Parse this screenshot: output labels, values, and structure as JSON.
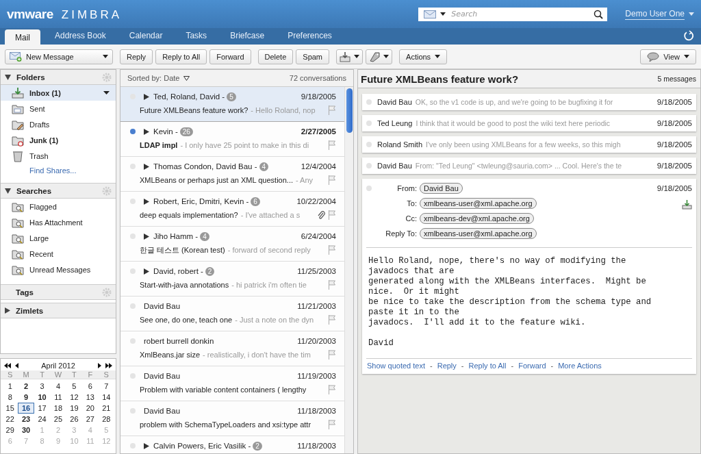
{
  "header": {
    "logo_brand": "vmware",
    "logo_product": "ZIMBRA",
    "search": {
      "placeholder": "Search"
    },
    "user": "Demo User One"
  },
  "tabs": [
    {
      "label": "Mail",
      "selected": true
    },
    {
      "label": "Address Book",
      "selected": false
    },
    {
      "label": "Calendar",
      "selected": false
    },
    {
      "label": "Tasks",
      "selected": false
    },
    {
      "label": "Briefcase",
      "selected": false
    },
    {
      "label": "Preferences",
      "selected": false
    }
  ],
  "toolbar": {
    "new_message": "New Message",
    "buttons": [
      "Reply",
      "Reply to All",
      "Forward",
      "Delete",
      "Spam"
    ],
    "actions": "Actions",
    "view": "View"
  },
  "sidebar": {
    "folders_title": "Folders",
    "folders": [
      {
        "name": "Inbox (1)",
        "kind": "inbox",
        "bold": true,
        "selected": true
      },
      {
        "name": "Sent",
        "kind": "sent",
        "bold": false,
        "selected": false
      },
      {
        "name": "Drafts",
        "kind": "drafts",
        "bold": false,
        "selected": false
      },
      {
        "name": "Junk (1)",
        "kind": "junk",
        "bold": true,
        "selected": false
      },
      {
        "name": "Trash",
        "kind": "trash",
        "bold": false,
        "selected": false
      }
    ],
    "find_shares": "Find Shares...",
    "searches_title": "Searches",
    "searches": [
      "Flagged",
      "Has Attachment",
      "Large",
      "Recent",
      "Unread Messages"
    ],
    "tags_title": "Tags",
    "zimlets_title": "Zimlets"
  },
  "calendar": {
    "month": "April 2012",
    "weekdays": [
      "S",
      "M",
      "T",
      "W",
      "T",
      "F",
      "S"
    ],
    "days": [
      {
        "day": "1",
        "bold": false,
        "outside": false,
        "selected": false
      },
      {
        "day": "2",
        "bold": true,
        "outside": false,
        "selected": false
      },
      {
        "day": "3",
        "bold": false,
        "outside": false,
        "selected": false
      },
      {
        "day": "4",
        "bold": false,
        "outside": false,
        "selected": false
      },
      {
        "day": "5",
        "bold": false,
        "outside": false,
        "selected": false
      },
      {
        "day": "6",
        "bold": false,
        "outside": false,
        "selected": false
      },
      {
        "day": "7",
        "bold": false,
        "outside": false,
        "selected": false
      },
      {
        "day": "8",
        "bold": false,
        "outside": false,
        "selected": false
      },
      {
        "day": "9",
        "bold": true,
        "outside": false,
        "selected": false
      },
      {
        "day": "10",
        "bold": true,
        "outside": false,
        "selected": false
      },
      {
        "day": "11",
        "bold": false,
        "outside": false,
        "selected": false
      },
      {
        "day": "12",
        "bold": false,
        "outside": false,
        "selected": false
      },
      {
        "day": "13",
        "bold": false,
        "outside": false,
        "selected": false
      },
      {
        "day": "14",
        "bold": false,
        "outside": false,
        "selected": false
      },
      {
        "day": "15",
        "bold": false,
        "outside": false,
        "selected": false
      },
      {
        "day": "16",
        "bold": true,
        "outside": false,
        "selected": true
      },
      {
        "day": "17",
        "bold": false,
        "outside": false,
        "selected": false
      },
      {
        "day": "18",
        "bold": false,
        "outside": false,
        "selected": false
      },
      {
        "day": "19",
        "bold": false,
        "outside": false,
        "selected": false
      },
      {
        "day": "20",
        "bold": false,
        "outside": false,
        "selected": false
      },
      {
        "day": "21",
        "bold": false,
        "outside": false,
        "selected": false
      },
      {
        "day": "22",
        "bold": false,
        "outside": false,
        "selected": false
      },
      {
        "day": "23",
        "bold": true,
        "outside": false,
        "selected": false
      },
      {
        "day": "24",
        "bold": false,
        "outside": false,
        "selected": false
      },
      {
        "day": "25",
        "bold": false,
        "outside": false,
        "selected": false
      },
      {
        "day": "26",
        "bold": false,
        "outside": false,
        "selected": false
      },
      {
        "day": "27",
        "bold": false,
        "outside": false,
        "selected": false
      },
      {
        "day": "28",
        "bold": false,
        "outside": false,
        "selected": false
      },
      {
        "day": "29",
        "bold": false,
        "outside": false,
        "selected": false
      },
      {
        "day": "30",
        "bold": true,
        "outside": false,
        "selected": false
      },
      {
        "day": "1",
        "bold": false,
        "outside": true,
        "selected": false
      },
      {
        "day": "2",
        "bold": false,
        "outside": true,
        "selected": false
      },
      {
        "day": "3",
        "bold": false,
        "outside": true,
        "selected": false
      },
      {
        "day": "4",
        "bold": false,
        "outside": true,
        "selected": false
      },
      {
        "day": "5",
        "bold": false,
        "outside": true,
        "selected": false
      },
      {
        "day": "6",
        "bold": false,
        "outside": true,
        "selected": false
      },
      {
        "day": "7",
        "bold": false,
        "outside": true,
        "selected": false
      },
      {
        "day": "8",
        "bold": false,
        "outside": true,
        "selected": false
      },
      {
        "day": "9",
        "bold": false,
        "outside": true,
        "selected": false
      },
      {
        "day": "10",
        "bold": false,
        "outside": true,
        "selected": false
      },
      {
        "day": "11",
        "bold": false,
        "outside": true,
        "selected": false
      },
      {
        "day": "12",
        "bold": false,
        "outside": true,
        "selected": false
      }
    ]
  },
  "list": {
    "sorted_by": "Sorted by: Date",
    "count": "72 conversations",
    "rows": [
      {
        "sender": "Ted, Roland, David -",
        "count": "5",
        "expandable": true,
        "date": "9/18/2005",
        "subject": "Future XMLBeans feature work?",
        "snippet": "- Hello Roland, nop",
        "unread": false,
        "selected": true,
        "attachment": false
      },
      {
        "sender": "Kevin -",
        "count": "26",
        "expandable": true,
        "date": "2/27/2005",
        "subject": "LDAP impl",
        "snippet": "- I only have 25 point to make in this di",
        "unread": true,
        "selected": false,
        "attachment": false
      },
      {
        "sender": "Thomas Condon, David Bau -",
        "count": "4",
        "expandable": true,
        "date": "12/4/2004",
        "subject": "XMLBeans or perhaps just an XML question...",
        "snippet": "- Any",
        "unread": false,
        "selected": false,
        "attachment": false
      },
      {
        "sender": "Robert, Eric, Dmitri, Kevin -",
        "count": "6",
        "expandable": true,
        "date": "10/22/2004",
        "subject": "deep equals implementation?",
        "snippet": "- I've attached a s",
        "unread": false,
        "selected": false,
        "attachment": true
      },
      {
        "sender": "Jiho Hamm -",
        "count": "4",
        "expandable": true,
        "date": "6/24/2004",
        "subject": "한글 테스트 (Korean test)",
        "snippet": "- forward of second reply",
        "unread": false,
        "selected": false,
        "attachment": false
      },
      {
        "sender": "David, robert -",
        "count": "2",
        "expandable": true,
        "date": "11/25/2003",
        "subject": "Start-with-java annotations",
        "snippet": "- hi patrick i'm often tie",
        "unread": false,
        "selected": false,
        "attachment": false
      },
      {
        "sender": "David Bau",
        "expandable": false,
        "date": "11/21/2003",
        "subject": "See one, do one, teach one",
        "snippet": "- Just a note on the dyn",
        "unread": false,
        "selected": false,
        "attachment": false
      },
      {
        "sender": "robert burrell donkin",
        "expandable": false,
        "date": "11/20/2003",
        "subject": "XmlBeans.jar size",
        "snippet": "- realistically, i don't have the tim",
        "unread": false,
        "selected": false,
        "attachment": false
      },
      {
        "sender": "David Bau",
        "expandable": false,
        "date": "11/19/2003",
        "subject": "Problem with variable content containers ( lengthy",
        "snippet": "",
        "unread": false,
        "selected": false,
        "attachment": false
      },
      {
        "sender": "David Bau",
        "expandable": false,
        "date": "11/18/2003",
        "subject": "problem with SchemaTypeLoaders and xsi:type attr",
        "snippet": "",
        "unread": false,
        "selected": false,
        "attachment": false
      },
      {
        "sender": "Calvin Powers, Eric Vasilik -",
        "count": "2",
        "expandable": true,
        "date": "11/18/2003",
        "unread": false,
        "selected": false,
        "attachment": false
      }
    ]
  },
  "reader": {
    "subject": "Future XMLBeans feature work?",
    "count": "5 messages",
    "collapsed": [
      {
        "sender": "David Bau",
        "snippet": "OK, so the v1 code is up, and we're going to be bugfixing it for",
        "date": "9/18/2005"
      },
      {
        "sender": "Ted Leung",
        "snippet": "I think that it would be good to post the wiki text here periodic",
        "date": "9/18/2005"
      },
      {
        "sender": "Roland Smith",
        "snippet": "I've only been using XMLBeans for a few weeks, so this migh",
        "date": "9/18/2005"
      },
      {
        "sender": "David Bau",
        "snippet": "From: \"Ted Leung\" <twleung@sauria.com> ... Cool. Here's the te",
        "date": "9/18/2005"
      }
    ],
    "message": {
      "date": "9/18/2005",
      "fields": [
        {
          "label": "From:",
          "value": "David Bau"
        },
        {
          "label": "To:",
          "value": "xmlbeans-user@xml.apache.org"
        },
        {
          "label": "Cc:",
          "value": "xmlbeans-dev@xml.apache.org"
        },
        {
          "label": "Reply To:",
          "value": "xmlbeans-user@xml.apache.org"
        }
      ],
      "body": "Hello Roland, nope, there's no way of modifying the\njavadocs that are\ngenerated along with the XMLBeans interfaces.  Might be\nnice.  Or it might\nbe nice to take the description from the schema type and\npaste it in to the\njavadocs.  I'll add it to the feature wiki.\n\nDavid",
      "actions": [
        "Show quoted text",
        "Reply",
        "Reply to All",
        "Forward",
        "More Actions"
      ],
      "separator": "-"
    }
  }
}
